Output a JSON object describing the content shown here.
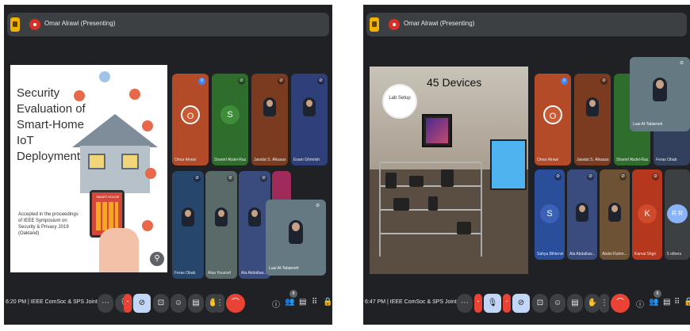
{
  "screens": [
    {
      "presenter": "Omar Alrawi (Presenting)",
      "slide": {
        "title": "Security Evaluation of Smart-Home IoT Deployments",
        "abstract": "Accepted in the proceedings of IEEE Symposium on Security & Privacy 2019 (Oakland)",
        "phone_label": "SMART HOUSE"
      },
      "tiles": [
        {
          "initial": "O",
          "name": "Omar Alrawi",
          "color": "#b34a28"
        },
        {
          "initial": "S",
          "name": "Sharief Abdel-Raz...",
          "color": "#2f6d2c"
        },
        {
          "name": "Jawdat S. Alkasas..."
        },
        {
          "name": "Esam Ghmrish"
        },
        {
          "name": "Feras Obab"
        },
        {
          "name": "Alaa Youssef"
        },
        {
          "name": "Ala Abdallaw..."
        }
      ],
      "self_view": {
        "name": "Luai Al-Tabarneh"
      },
      "meeting_info": "6:20 PM | IEEE ComSoc & SPS Joint Ch...",
      "people_count": "8"
    },
    {
      "presenter": "Omar Alrawi (Presenting)",
      "slide": {
        "heading": "45 Devices",
        "label": "Lab Setup"
      },
      "tiles": [
        {
          "initial": "O",
          "name": "Omar Alrawi",
          "color": "#b34a28"
        },
        {
          "name": "Jawdat S. Alkasas..."
        },
        {
          "name": "Sharief Abdel-Raz..."
        },
        {
          "name": "Feras Obab"
        },
        {
          "initial": "S",
          "name": "Sahya Bihtenst",
          "color": "#2b4e9a"
        },
        {
          "name": "Ala Abdallaw..."
        },
        {
          "name": "Abdel Rahm..."
        },
        {
          "initial": "K",
          "name": "Kamal Shgir",
          "color": "#b5381e"
        }
      ],
      "others": {
        "name": "5 others",
        "initials": "R R"
      },
      "self_view": {
        "name": "Luai Al-Tabarneh"
      },
      "meeting_info": "6:47 PM | IEEE ComSoc & SPS Joint Ch...",
      "people_count": "8"
    }
  ],
  "icons": {
    "more": "⋯",
    "mic": "🎙",
    "cam": "⊘",
    "present": "⊡",
    "emoji": "☺",
    "cc": "▤",
    "hand": "✋",
    "dots": "⋮",
    "hangup": "⌒",
    "info": "ⓘ",
    "people": "👥",
    "chat": "▤",
    "activities": "⠿",
    "lock": "🔒"
  }
}
